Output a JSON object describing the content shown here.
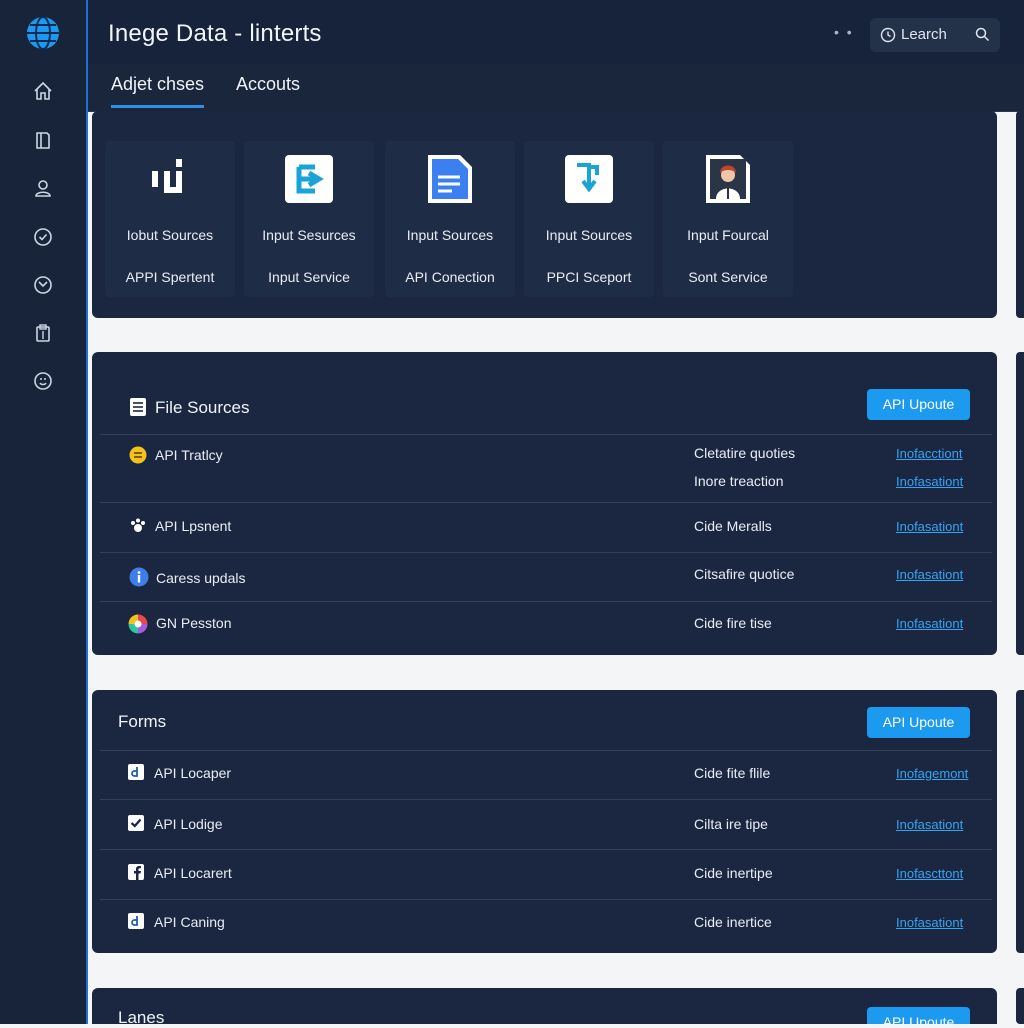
{
  "app": {
    "title": "Inege Data - linterts",
    "dots": "• •"
  },
  "search": {
    "label": "Learch"
  },
  "tabs": [
    {
      "label": "Adjet chses",
      "active": true
    },
    {
      "label": "Accouts",
      "active": false
    }
  ],
  "sidebar": {
    "icons": [
      "home-icon",
      "book-icon",
      "user-icon",
      "check-circle-icon",
      "compass-icon",
      "clipboard-icon",
      "emoji-icon"
    ]
  },
  "sources_panel": {
    "cards": [
      {
        "icon": "brackets-icon",
        "title": "Iobut Sources",
        "subtitle": "APPI Spertent"
      },
      {
        "icon": "arrow-square-icon",
        "title": "Input Sesurces",
        "subtitle": "Input Service"
      },
      {
        "icon": "document-icon",
        "title": "Input Sources",
        "subtitle": "API Conection"
      },
      {
        "icon": "download-doc-icon",
        "title": "Input Sources",
        "subtitle": "PPCI Sceport"
      },
      {
        "icon": "person-doc-icon",
        "title": "Input Fourcal",
        "subtitle": "Sont Service"
      }
    ]
  },
  "file_sources": {
    "title": "File Sources",
    "button": "API Upoute",
    "rows": [
      {
        "icon": "smiley-icon",
        "name": "API Tratlcy",
        "desc": "Cletatire quoties",
        "link": "Inofacctiont"
      },
      {
        "icon": "",
        "name": "",
        "desc": "Inore treaction",
        "link": "Inofasationt"
      },
      {
        "icon": "paw-icon",
        "name": "API Lpsnent",
        "desc": "Cide Meralls",
        "link": "Inofasationt"
      },
      {
        "icon": "info-icon",
        "name": "Caress updals",
        "desc": "Citsafire quotice",
        "link": "Inofasationt"
      },
      {
        "icon": "colorwheel-icon",
        "name": "GN Pesston",
        "desc": "Cide fire tise",
        "link": "Inofasationt"
      }
    ]
  },
  "forms": {
    "title": "Forms",
    "button": "API Upoute",
    "rows": [
      {
        "icon": "d-square-icon",
        "name": "API Locaper",
        "desc": "Cide fite flile",
        "link": "Inofagemont"
      },
      {
        "icon": "checkbox-icon",
        "name": "API Lodige",
        "desc": "Cilta ire tipe",
        "link": "Inofasationt"
      },
      {
        "icon": "facebook-icon",
        "name": "API Locarert",
        "desc": "Cide inertipe",
        "link": "Inofascttont"
      },
      {
        "icon": "d-square-icon",
        "name": "API Caning",
        "desc": "Cide inertice",
        "link": "Inofasationt"
      }
    ]
  },
  "lanes": {
    "title": "Lanes",
    "button": "API Upoute"
  },
  "colors": {
    "accent": "#1c9af0",
    "sidebar": "#18243a",
    "panel": "#1b2740",
    "link": "#35a4f4"
  }
}
